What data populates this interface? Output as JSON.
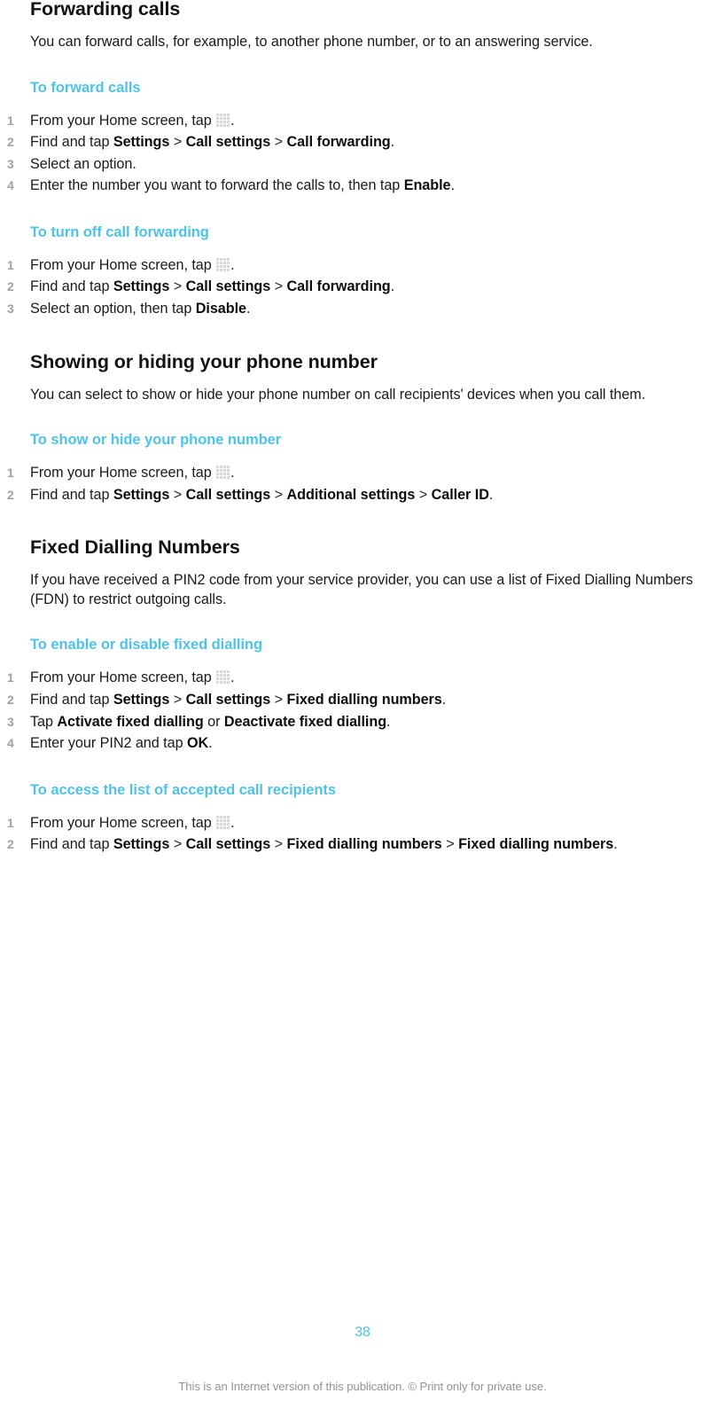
{
  "document": {
    "page_number": "38",
    "footer_note": "This is an Internet version of this publication. © Print only for private use.",
    "accent_color": "#4ec3e8",
    "body_color": "#1a1a1a",
    "list_number_color": "#a0a0a0"
  },
  "icons": {
    "app_drawer": "app-drawer-grid-icon"
  },
  "sections": [
    {
      "heading": "Forwarding calls",
      "paragraph": "You can forward calls, for example, to another phone number, or to an answering service.",
      "tasks": [
        {
          "title": "To forward calls",
          "steps": [
            {
              "number": "1",
              "parts": [
                {
                  "t": "text",
                  "v": "From your Home screen, tap "
                },
                {
                  "t": "icon",
                  "v": "app-drawer-grid-icon"
                },
                {
                  "t": "text",
                  "v": "."
                }
              ]
            },
            {
              "number": "2",
              "parts": [
                {
                  "t": "text",
                  "v": "Find and tap "
                },
                {
                  "t": "bold",
                  "v": "Settings"
                },
                {
                  "t": "sep",
                  "v": " > "
                },
                {
                  "t": "bold",
                  "v": "Call settings"
                },
                {
                  "t": "sep",
                  "v": " > "
                },
                {
                  "t": "bold",
                  "v": "Call forwarding"
                },
                {
                  "t": "text",
                  "v": "."
                }
              ]
            },
            {
              "number": "3",
              "parts": [
                {
                  "t": "text",
                  "v": "Select an option."
                }
              ]
            },
            {
              "number": "4",
              "parts": [
                {
                  "t": "text",
                  "v": "Enter the number you want to forward the calls to, then tap "
                },
                {
                  "t": "bold",
                  "v": "Enable"
                },
                {
                  "t": "text",
                  "v": "."
                }
              ]
            }
          ]
        },
        {
          "title": "To turn off call forwarding",
          "steps": [
            {
              "number": "1",
              "parts": [
                {
                  "t": "text",
                  "v": "From your Home screen, tap "
                },
                {
                  "t": "icon",
                  "v": "app-drawer-grid-icon"
                },
                {
                  "t": "text",
                  "v": "."
                }
              ]
            },
            {
              "number": "2",
              "parts": [
                {
                  "t": "text",
                  "v": "Find and tap "
                },
                {
                  "t": "bold",
                  "v": "Settings"
                },
                {
                  "t": "sep",
                  "v": " > "
                },
                {
                  "t": "bold",
                  "v": "Call settings"
                },
                {
                  "t": "sep",
                  "v": " > "
                },
                {
                  "t": "bold",
                  "v": "Call forwarding"
                },
                {
                  "t": "text",
                  "v": "."
                }
              ]
            },
            {
              "number": "3",
              "parts": [
                {
                  "t": "text",
                  "v": "Select an option, then tap "
                },
                {
                  "t": "bold",
                  "v": "Disable"
                },
                {
                  "t": "text",
                  "v": "."
                }
              ]
            }
          ]
        }
      ]
    },
    {
      "heading": "Showing or hiding your phone number",
      "paragraph": "You can select to show or hide your phone number on call recipients' devices when you call them.",
      "tasks": [
        {
          "title": "To show or hide your phone number",
          "steps": [
            {
              "number": "1",
              "parts": [
                {
                  "t": "text",
                  "v": "From your Home screen, tap "
                },
                {
                  "t": "icon",
                  "v": "app-drawer-grid-icon"
                },
                {
                  "t": "text",
                  "v": "."
                }
              ]
            },
            {
              "number": "2",
              "parts": [
                {
                  "t": "text",
                  "v": "Find and tap "
                },
                {
                  "t": "bold",
                  "v": "Settings"
                },
                {
                  "t": "sep",
                  "v": " > "
                },
                {
                  "t": "bold",
                  "v": "Call settings"
                },
                {
                  "t": "sep",
                  "v": " > "
                },
                {
                  "t": "bold",
                  "v": "Additional settings"
                },
                {
                  "t": "sep",
                  "v": " > "
                },
                {
                  "t": "bold",
                  "v": "Caller ID"
                },
                {
                  "t": "text",
                  "v": "."
                }
              ]
            }
          ]
        }
      ]
    },
    {
      "heading": "Fixed Dialling Numbers",
      "paragraph": "If you have received a PIN2 code from your service provider, you can use a list of Fixed Dialling Numbers (FDN) to restrict outgoing calls.",
      "tasks": [
        {
          "title": "To enable or disable fixed dialling",
          "steps": [
            {
              "number": "1",
              "parts": [
                {
                  "t": "text",
                  "v": "From your Home screen, tap "
                },
                {
                  "t": "icon",
                  "v": "app-drawer-grid-icon"
                },
                {
                  "t": "text",
                  "v": "."
                }
              ]
            },
            {
              "number": "2",
              "parts": [
                {
                  "t": "text",
                  "v": "Find and tap "
                },
                {
                  "t": "bold",
                  "v": "Settings"
                },
                {
                  "t": "sep",
                  "v": " > "
                },
                {
                  "t": "bold",
                  "v": "Call settings"
                },
                {
                  "t": "sep",
                  "v": " > "
                },
                {
                  "t": "bold",
                  "v": "Fixed dialling numbers"
                },
                {
                  "t": "text",
                  "v": "."
                }
              ]
            },
            {
              "number": "3",
              "parts": [
                {
                  "t": "text",
                  "v": "Tap "
                },
                {
                  "t": "bold",
                  "v": "Activate fixed dialling"
                },
                {
                  "t": "text",
                  "v": " or "
                },
                {
                  "t": "bold",
                  "v": "Deactivate fixed dialling"
                },
                {
                  "t": "text",
                  "v": "."
                }
              ]
            },
            {
              "number": "4",
              "parts": [
                {
                  "t": "text",
                  "v": "Enter your PIN2 and tap "
                },
                {
                  "t": "bold",
                  "v": "OK"
                },
                {
                  "t": "text",
                  "v": "."
                }
              ]
            }
          ]
        },
        {
          "title": "To access the list of accepted call recipients",
          "steps": [
            {
              "number": "1",
              "parts": [
                {
                  "t": "text",
                  "v": "From your Home screen, tap "
                },
                {
                  "t": "icon",
                  "v": "app-drawer-grid-icon"
                },
                {
                  "t": "text",
                  "v": "."
                }
              ]
            },
            {
              "number": "2",
              "parts": [
                {
                  "t": "text",
                  "v": "Find and tap "
                },
                {
                  "t": "bold",
                  "v": "Settings"
                },
                {
                  "t": "sep",
                  "v": " > "
                },
                {
                  "t": "bold",
                  "v": "Call settings"
                },
                {
                  "t": "sep",
                  "v": " > "
                },
                {
                  "t": "bold",
                  "v": "Fixed dialling numbers"
                },
                {
                  "t": "sep",
                  "v": " > "
                },
                {
                  "t": "bold",
                  "v": "Fixed dialling numbers"
                },
                {
                  "t": "text",
                  "v": "."
                }
              ]
            }
          ]
        }
      ]
    }
  ]
}
